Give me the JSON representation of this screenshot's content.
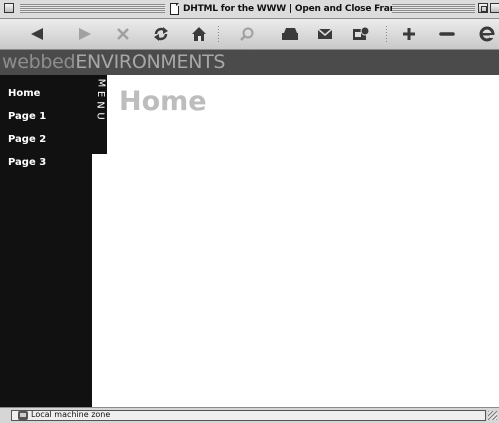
{
  "window": {
    "title": "DHTML for the WWW | Open and Close Frames"
  },
  "toolbar": {
    "buttons": [
      {
        "icon": "back-arrow-icon",
        "enabled": true
      },
      {
        "icon": "forward-arrow-icon",
        "enabled": false
      },
      {
        "icon": "stop-icon",
        "enabled": false
      },
      {
        "icon": "refresh-icon",
        "enabled": true
      },
      {
        "icon": "home-icon",
        "enabled": true
      },
      {
        "icon": "search-icon",
        "enabled": false
      },
      {
        "icon": "print-icon",
        "enabled": true
      },
      {
        "icon": "mail-icon",
        "enabled": true
      },
      {
        "icon": "preferences-icon",
        "enabled": true
      },
      {
        "icon": "text-larger-icon",
        "enabled": true
      },
      {
        "icon": "text-smaller-icon",
        "enabled": true
      },
      {
        "icon": "browser-logo-icon",
        "enabled": true
      }
    ]
  },
  "banner": {
    "logo_part1": "webbed",
    "logo_part2": "ENVIRONMENTS"
  },
  "menu_tab": {
    "letters": [
      "M",
      "E",
      "N",
      "U"
    ]
  },
  "sidebar": {
    "items": [
      {
        "label": "Home"
      },
      {
        "label": "Page 1"
      },
      {
        "label": "Page 2"
      },
      {
        "label": "Page 3"
      }
    ]
  },
  "page": {
    "title": "Home"
  },
  "status": {
    "zone_text": "Local machine zone"
  },
  "colors": {
    "sidebar_bg": "#111111",
    "banner_bg": "#4b4b4b",
    "page_title": "#bdbdbd",
    "logo_light": "#8e8e8e",
    "logo_lighter": "#a7a7a7"
  }
}
